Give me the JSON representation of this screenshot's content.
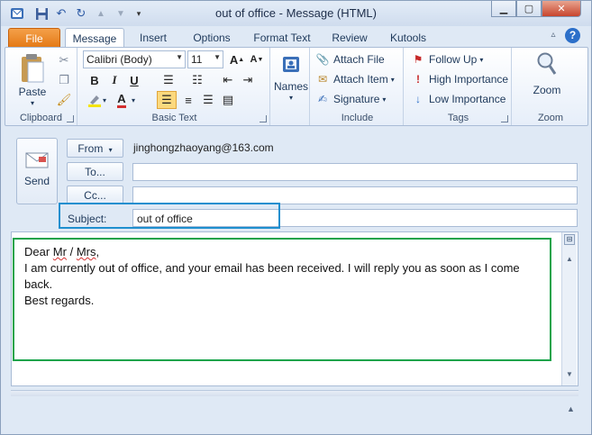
{
  "window": {
    "title": "out of office",
    "title_suffix": "-  Message (HTML)",
    "controls": {
      "minimize": "▁",
      "maximize": "▢",
      "close": "✕"
    }
  },
  "qat": [
    "outlook-icon",
    "save-icon",
    "undo-icon",
    "redo-icon",
    "up-arrow-icon",
    "down-arrow-icon",
    "customize-icon"
  ],
  "tabs": [
    {
      "label": "File",
      "active": false
    },
    {
      "label": "Message",
      "active": true
    },
    {
      "label": "Insert",
      "active": false
    },
    {
      "label": "Options",
      "active": false
    },
    {
      "label": "Format Text",
      "active": false
    },
    {
      "label": "Review",
      "active": false
    },
    {
      "label": "Kutools",
      "active": false
    }
  ],
  "ribbon": {
    "clipboard": {
      "label": "Clipboard",
      "paste": "Paste"
    },
    "basic_text": {
      "label": "Basic Text",
      "font": "Calibri (Body)",
      "size": "11"
    },
    "names": {
      "label": "Names"
    },
    "include": {
      "label": "Include",
      "attach_file": "Attach File",
      "attach_item": "Attach Item",
      "signature": "Signature"
    },
    "tags": {
      "label": "Tags",
      "follow_up": "Follow Up",
      "high_importance": "High Importance",
      "low_importance": "Low Importance"
    },
    "zoom": {
      "label": "Zoom",
      "button": "Zoom"
    }
  },
  "compose": {
    "send": "Send",
    "from_label": "From",
    "from_value": "jinghongzhaoyang@163.com",
    "to_label": "To...",
    "to_value": "",
    "cc_label": "Cc...",
    "cc_value": "",
    "subject_label": "Subject:",
    "subject_value": "out of office"
  },
  "body": {
    "dear": "Dear ",
    "mr": "Mr",
    "slash": " / ",
    "mrs": "Mrs",
    "comma": ",",
    "line2": "I am currently out of office, and your email has been received. I will reply you as soon as I come back.",
    "line3": "Best regards."
  },
  "colors": {
    "file_tab": "#e47a17",
    "subject_highlight": "#1f8fcf",
    "body_highlight": "#16a34a",
    "help_icon": "#2c6fc9",
    "font_color_bar": "#d32f2f",
    "highlight_bar": "#f5e400"
  }
}
